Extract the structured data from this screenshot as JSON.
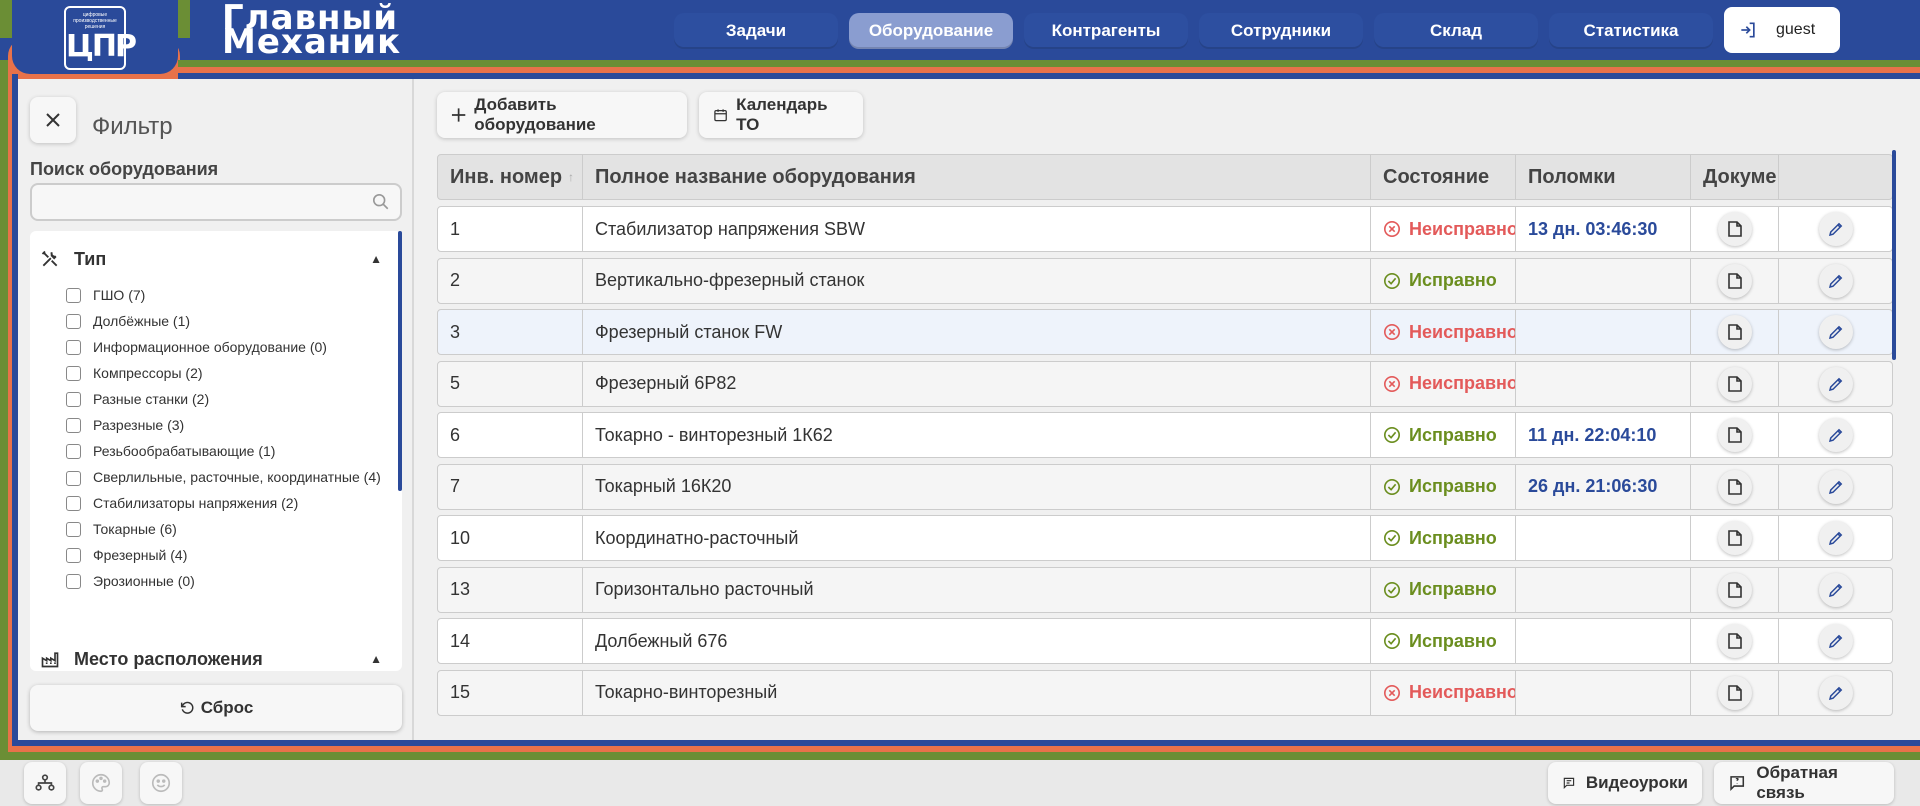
{
  "brand": {
    "line1": "Главный",
    "line2": "Механик",
    "logo_small": "цифровые производственные решения",
    "logo_main": "ЦПР"
  },
  "nav": [
    {
      "label": "Задачи"
    },
    {
      "label": "Оборудование"
    },
    {
      "label": "Контрагенты"
    },
    {
      "label": "Сотрудники"
    },
    {
      "label": "Склад"
    },
    {
      "label": "Статистика"
    }
  ],
  "user": {
    "name": "guest"
  },
  "sidebar": {
    "title": "Фильтр",
    "search_label": "Поиск оборудования",
    "search_value": "",
    "type_section": "Тип",
    "types": [
      "ГШО (7)",
      "Долбёжные (1)",
      "Информационное оборудование (0)",
      "Компрессоры (2)",
      "Разные станки (2)",
      "Разрезные (3)",
      "Резьбообрабатывающие (1)",
      "Сверлильные, расточные, координатные (4)",
      "Стабилизаторы напряжения (2)",
      "Токарные (6)",
      "Фрезерный (4)",
      "Эрозионные (0)"
    ],
    "location_section": "Место расположения",
    "reset_label": "Сброс"
  },
  "toolbar": {
    "add_label": "Добавить оборудование",
    "calendar_label": "Календарь ТО"
  },
  "table": {
    "headers": [
      "Инв. номер",
      "Полное название оборудования",
      "Состояние",
      "Поломки",
      "Докуме"
    ],
    "rows": [
      {
        "inv": "1",
        "name": "Стабилизатор напряжения SBW",
        "status": "Неисправно",
        "ok": false,
        "breakdown": "13 дн. 03:46:30"
      },
      {
        "inv": "2",
        "name": "Вертикально-фрезерный станок",
        "status": "Исправно",
        "ok": true,
        "breakdown": ""
      },
      {
        "inv": "3",
        "name": "Фрезерный станок FW",
        "status": "Неисправно",
        "ok": false,
        "breakdown": ""
      },
      {
        "inv": "5",
        "name": "Фрезерный 6Р82",
        "status": "Неисправно",
        "ok": false,
        "breakdown": ""
      },
      {
        "inv": "6",
        "name": "Токарно - винторезный 1К62",
        "status": "Исправно",
        "ok": true,
        "breakdown": "11 дн. 22:04:10"
      },
      {
        "inv": "7",
        "name": "Токарный 16К20",
        "status": "Исправно",
        "ok": true,
        "breakdown": "26 дн. 21:06:30"
      },
      {
        "inv": "10",
        "name": "Координатно-расточный",
        "status": "Исправно",
        "ok": true,
        "breakdown": ""
      },
      {
        "inv": "13",
        "name": "Горизонтально расточный",
        "status": "Исправно",
        "ok": true,
        "breakdown": ""
      },
      {
        "inv": "14",
        "name": "Долбежный 676",
        "status": "Исправно",
        "ok": true,
        "breakdown": ""
      },
      {
        "inv": "15",
        "name": "Токарно-винторезный",
        "status": "Неисправно",
        "ok": false,
        "breakdown": ""
      }
    ]
  },
  "bottom": {
    "videos_label": "Видеоуроки",
    "feedback_label": "Обратная связь"
  },
  "colors": {
    "blue": "#2a4a9a",
    "green": "#6b8e35",
    "orange": "#e8724a",
    "ok": "#6b8e1f",
    "bad": "#e35a5a"
  }
}
